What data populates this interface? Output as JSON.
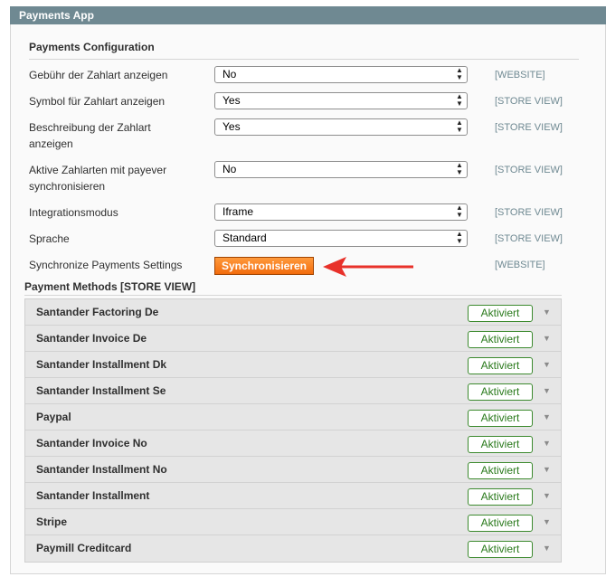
{
  "section": {
    "title": "Payments App"
  },
  "config": {
    "title": "Payments Configuration",
    "rows": [
      {
        "label": "Gebühr der Zahlart anzeigen",
        "value": "No",
        "scope": "[WEBSITE]"
      },
      {
        "label": "Symbol für Zahlart anzeigen",
        "value": "Yes",
        "scope": "[STORE VIEW]"
      },
      {
        "label": "Beschreibung der Zahlart anzeigen",
        "value": "Yes",
        "scope": "[STORE VIEW]"
      },
      {
        "label": "Aktive Zahlarten mit payever synchronisieren",
        "value": "No",
        "scope": "[STORE VIEW]"
      },
      {
        "label": "Integrationsmodus",
        "value": "Iframe",
        "scope": "[STORE VIEW]"
      },
      {
        "label": "Sprache",
        "value": "Standard",
        "scope": "[STORE VIEW]"
      }
    ],
    "sync": {
      "label": "Synchronize Payments Settings",
      "button": "Synchronisieren",
      "scope": "[WEBSITE]"
    }
  },
  "methods": {
    "title": "Payment Methods [STORE VIEW]",
    "items": [
      {
        "name": "Santander Factoring De",
        "status": "Aktiviert"
      },
      {
        "name": "Santander Invoice De",
        "status": "Aktiviert"
      },
      {
        "name": "Santander Installment Dk",
        "status": "Aktiviert"
      },
      {
        "name": "Santander Installment Se",
        "status": "Aktiviert"
      },
      {
        "name": "Paypal",
        "status": "Aktiviert"
      },
      {
        "name": "Santander Invoice No",
        "status": "Aktiviert"
      },
      {
        "name": "Santander Installment No",
        "status": "Aktiviert"
      },
      {
        "name": "Santander Installment",
        "status": "Aktiviert"
      },
      {
        "name": "Stripe",
        "status": "Aktiviert"
      },
      {
        "name": "Paymill Creditcard",
        "status": "Aktiviert"
      }
    ]
  },
  "colors": {
    "header_bg": "#6f8992",
    "button_orange": "#f26b0c",
    "badge_green": "#3c8a2e",
    "annotation_arrow": "#e8312a"
  },
  "icons": {
    "select_chevron": "chevron-updown-icon",
    "row_caret": "caret-down-icon",
    "annotation": "arrow-left-icon"
  }
}
